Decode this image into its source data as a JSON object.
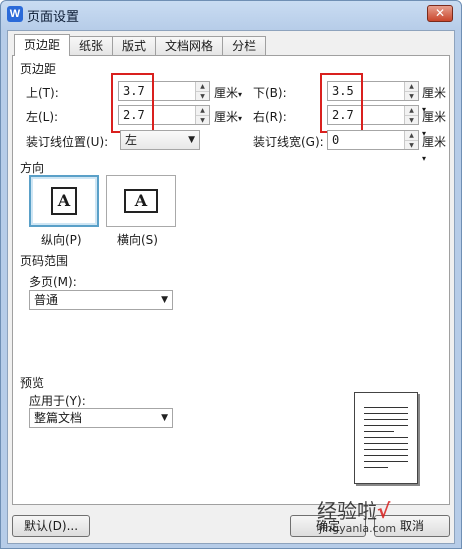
{
  "window": {
    "title": "页面设置",
    "app_icon_letter": "W",
    "close_symbol": "✕"
  },
  "tabs": [
    "页边距",
    "纸张",
    "版式",
    "文档网格",
    "分栏"
  ],
  "active_tab": "页边距",
  "margins": {
    "section_title": "页边距",
    "top_label": "上(T):",
    "top_value": "3.7",
    "left_label": "左(L):",
    "left_value": "2.7",
    "bottom_label": "下(B):",
    "bottom_value": "3.5",
    "right_label": "右(R):",
    "right_value": "2.7",
    "gutter_pos_label": "装订线位置(U):",
    "gutter_pos_value": "左",
    "gutter_width_label": "装订线宽(G):",
    "gutter_width_value": "0",
    "unit": "厘米",
    "highlight_color": "#d9201e"
  },
  "orientation": {
    "section_title": "方向",
    "portrait_label": "纵向(P)",
    "landscape_label": "横向(S)",
    "icon_letter": "A",
    "selected": "纵向(P)"
  },
  "page_range": {
    "section_title": "页码范围",
    "multi_page_label": "多页(M):",
    "multi_page_value": "普通"
  },
  "preview": {
    "section_title": "预览",
    "apply_to_label": "应用于(Y):",
    "apply_to_value": "整篇文档"
  },
  "buttons": {
    "default_label": "默认(D)...",
    "ok_label": "确定",
    "cancel_label": "取消"
  },
  "watermark": {
    "text": "经验啦",
    "check": "√",
    "url": "jingyanla.com"
  }
}
